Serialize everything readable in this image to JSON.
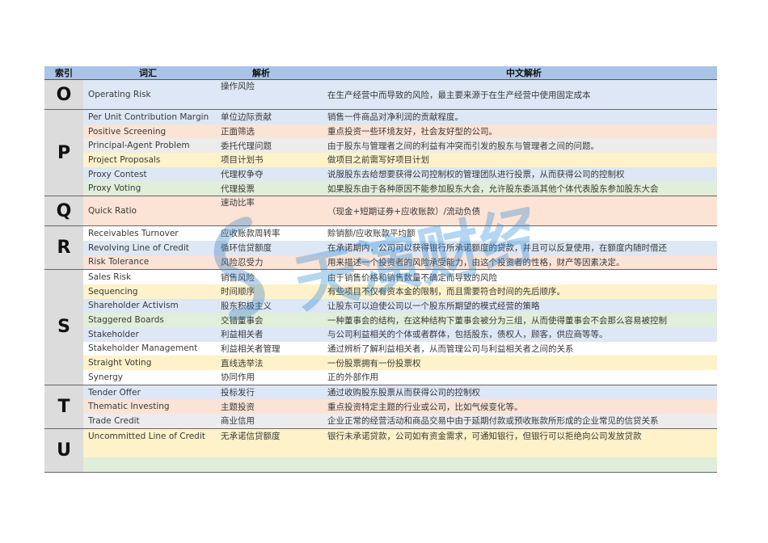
{
  "headers": [
    "索引",
    "词汇",
    "解析",
    "中文解析"
  ],
  "groups": [
    {
      "letter": "O",
      "rows": [
        {
          "term": "Operating Risk",
          "cn": "操作风险",
          "desc": "在生产经营中而导致的风险，最主要来源于在生产经营中使用固定成本",
          "bg": "blue",
          "tall": true
        }
      ]
    },
    {
      "letter": "P",
      "rows": [
        {
          "term": "Per Unit Contribution Margin",
          "cn": "单位边际贡献",
          "desc": "销售一件商品对净利润的贡献程度。",
          "bg": "blue"
        },
        {
          "term": "Positive Screening",
          "cn": "正面筛选",
          "desc": "重点投资一些环境友好，社会友好型的公司。",
          "bg": "peach"
        },
        {
          "term": "Principal-Agent Problem",
          "cn": "委托代理问题",
          "desc": "由于股东与管理者之间的利益有冲突而引发的股东与管理者之间的问题。",
          "bg": "gray"
        },
        {
          "term": "Project Proposals",
          "cn": "项目计划书",
          "desc": "做项目之前需写好项目计划",
          "bg": "yellow"
        },
        {
          "term": "Proxy Contest",
          "cn": "代理权争夺",
          "desc": "说服股东去给想要获得公司控制权的管理团队进行投票，从而获得公司的控制权",
          "bg": "blue"
        },
        {
          "term": "Proxy Voting",
          "cn": "代理投票",
          "desc": "如果股东由于各种原因不能参加股东大会，允许股东委派其他个体代表股东参加股东大会",
          "bg": "green"
        }
      ]
    },
    {
      "letter": "Q",
      "rows": [
        {
          "term": "Quick Ratio",
          "cn": "速动比率",
          "desc": "（现金+短期证券+应收账款）/流动负债",
          "bg": "peach",
          "tall": true
        }
      ]
    },
    {
      "letter": "R",
      "rows": [
        {
          "term": "Receivables Turnover",
          "cn": "应收账款周转率",
          "desc": "赊销额/应收账款平均额",
          "bg": "white"
        },
        {
          "term": "Revolving Line of Credit",
          "cn": "循环信贷额度",
          "desc": "在承诺期内，公司可以获得银行所承诺额度的贷款，并且可以反复使用，在额度内随时借还",
          "bg": "blue"
        },
        {
          "term": "Risk Tolerance",
          "cn": "风险忍受力",
          "desc": "用来描述一个投资者的风险承受能力，由这个投资者的性格，财产等因素决定。",
          "bg": "peach"
        }
      ]
    },
    {
      "letter": "S",
      "rows": [
        {
          "term": "Sales Risk",
          "cn": "销售风险",
          "desc": "由于销售价格和销售数量不确定而导致的风险",
          "bg": "white"
        },
        {
          "term": "Sequencing",
          "cn": "时间顺序",
          "desc": "有些项目不仅有资本金的限制，而且需要符合时间的先后顺序。",
          "bg": "yellow"
        },
        {
          "term": "Shareholder Activism",
          "cn": "股东积极主义",
          "desc": "让股东可以迫使公司以一个股东所期望的模式经营的策略",
          "bg": "blue"
        },
        {
          "term": "Staggered Boards",
          "cn": "交错董事会",
          "desc": "一种董事会的结构，在这种结构下董事会被分为三组，从而使得董事会不会那么容易被控制",
          "bg": "green"
        },
        {
          "term": "Stakeholder",
          "cn": "利益相关者",
          "desc": "与公司利益相关的个体或者群体，包括股东，债权人，顾客，供应商等等。",
          "bg": "blue"
        },
        {
          "term": "Stakeholder Management",
          "cn": "利益相关者管理",
          "desc": "通过辨析了解利益相关者，从而管理公司与利益相关者之间的关系",
          "bg": "white"
        },
        {
          "term": "Straight Voting",
          "cn": "直线选举法",
          "desc": "一份股票拥有一份投票权",
          "bg": "yellow"
        },
        {
          "term": "Synergy",
          "cn": "协同作用",
          "desc": "正的外部作用",
          "bg": "white"
        }
      ]
    },
    {
      "letter": "T",
      "rows": [
        {
          "term": "Tender Offer",
          "cn": "投标发行",
          "desc": "通过收购股东股票从而获得公司的控制权",
          "bg": "blue"
        },
        {
          "term": "Thematic Investing",
          "cn": "主题投资",
          "desc": "重点投资特定主题的行业或公司，比如气候变化等。",
          "bg": "peach"
        },
        {
          "term": "Trade Credit",
          "cn": "商业信用",
          "desc": "企业正常的经营活动和商品交易中由于延期付款或预收账款所形成的企业常见的信贷关系",
          "bg": "gray"
        }
      ]
    },
    {
      "letter": "U",
      "rows": [
        {
          "term": "Uncommitted Line of Credit",
          "cn": "无承诺信贷额度",
          "desc": "银行未承诺贷款，公司如有资金需求，可通知银行，但银行可以拒绝向公司发放贷款",
          "bg": "yellow"
        },
        {
          "term": "",
          "cn": "",
          "desc": "",
          "bg": "yellow"
        },
        {
          "term": "",
          "cn": "",
          "desc": "",
          "bg": "green"
        }
      ]
    }
  ],
  "watermark": {
    "text": "天演财经"
  }
}
